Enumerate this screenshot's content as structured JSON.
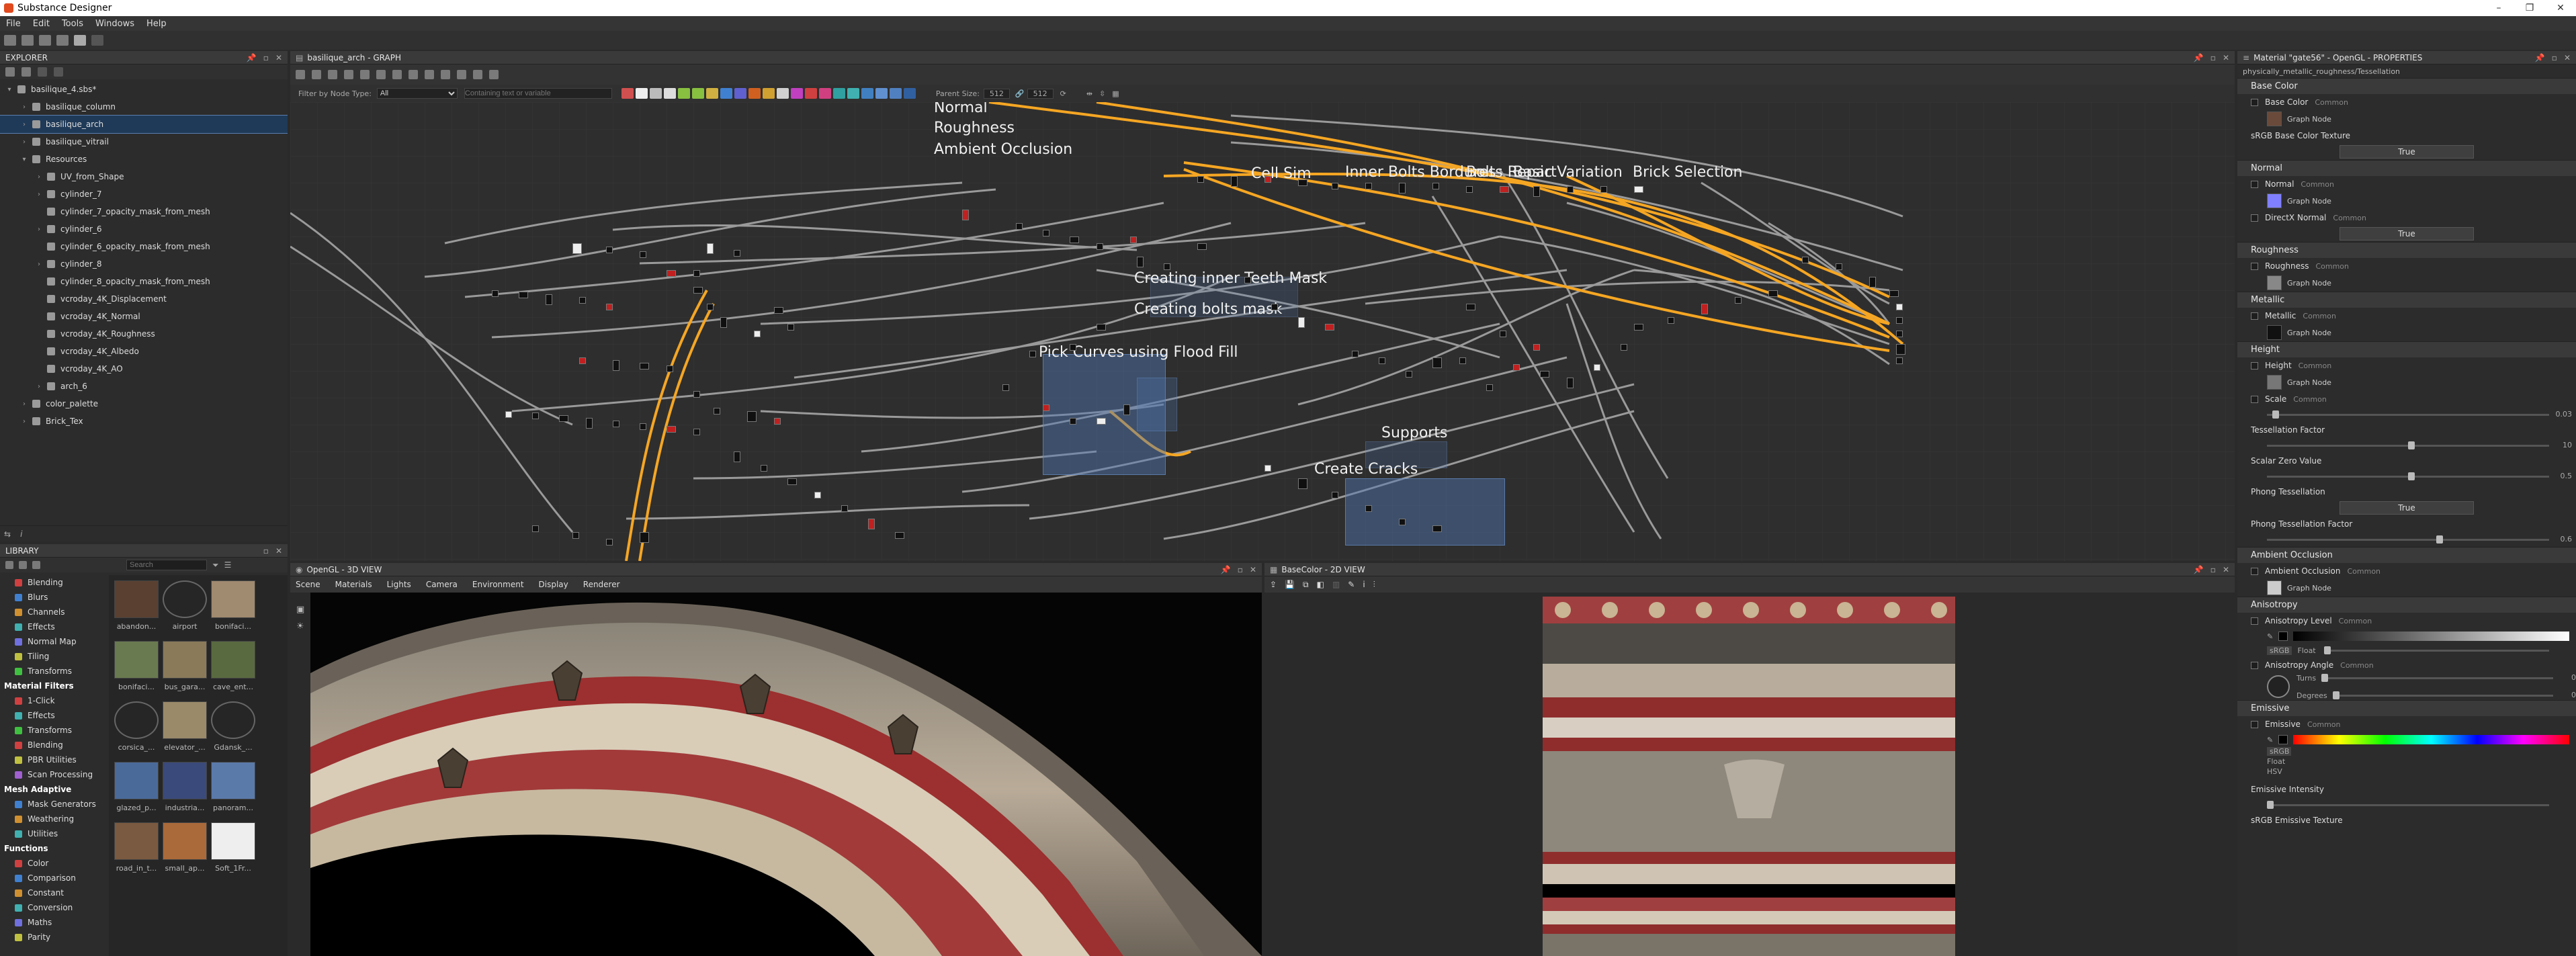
{
  "app": {
    "title": "Substance Designer"
  },
  "menu": [
    "File",
    "Edit",
    "Tools",
    "Windows",
    "Help"
  ],
  "explorer": {
    "title": "EXPLORER",
    "items": [
      {
        "label": "basilique_4.sbs*",
        "level": 0,
        "tw": "▾"
      },
      {
        "label": "basilique_column",
        "level": 1,
        "tw": "›"
      },
      {
        "label": "basilique_arch",
        "level": 1,
        "tw": "›",
        "selected": true
      },
      {
        "label": "basilique_vitrail",
        "level": 1,
        "tw": "›"
      },
      {
        "label": "Resources",
        "level": 1,
        "tw": "▾"
      },
      {
        "label": "UV_from_Shape",
        "level": 2,
        "tw": "›"
      },
      {
        "label": "cylinder_7",
        "level": 2,
        "tw": "›"
      },
      {
        "label": "cylinder_7_opacity_mask_from_mesh",
        "level": 2,
        "tw": ""
      },
      {
        "label": "cylinder_6",
        "level": 2,
        "tw": "›"
      },
      {
        "label": "cylinder_6_opacity_mask_from_mesh",
        "level": 2,
        "tw": ""
      },
      {
        "label": "cylinder_8",
        "level": 2,
        "tw": "›"
      },
      {
        "label": "cylinder_8_opacity_mask_from_mesh",
        "level": 2,
        "tw": ""
      },
      {
        "label": "vcroday_4K_Displacement",
        "level": 2,
        "tw": ""
      },
      {
        "label": "vcroday_4K_Normal",
        "level": 2,
        "tw": ""
      },
      {
        "label": "vcroday_4K_Roughness",
        "level": 2,
        "tw": ""
      },
      {
        "label": "vcroday_4K_Albedo",
        "level": 2,
        "tw": ""
      },
      {
        "label": "vcroday_4K_AO",
        "level": 2,
        "tw": ""
      },
      {
        "label": "arch_6",
        "level": 2,
        "tw": "›"
      },
      {
        "label": "color_palette",
        "level": 1,
        "tw": "›"
      },
      {
        "label": "Brick_Tex",
        "level": 1,
        "tw": "›"
      }
    ]
  },
  "library": {
    "title": "LIBRARY",
    "search_placeholder": "Search",
    "groups": [
      {
        "label": "Blending",
        "color": "#d04040"
      },
      {
        "label": "Blurs",
        "color": "#4080d0"
      },
      {
        "label": "Channels",
        "color": "#d09030"
      },
      {
        "label": "Effects",
        "color": "#40b0b0"
      },
      {
        "label": "Normal Map",
        "color": "#7070e0"
      },
      {
        "label": "Tiling",
        "color": "#c0c040"
      },
      {
        "label": "Transforms",
        "color": "#40c040"
      }
    ],
    "section2": "Material Filters",
    "group2": [
      {
        "label": "1-Click",
        "color": "#d04040"
      },
      {
        "label": "Effects",
        "color": "#40b0b0"
      },
      {
        "label": "Transforms",
        "color": "#40c040"
      },
      {
        "label": "Blending",
        "color": "#d04040"
      },
      {
        "label": "PBR Utilities",
        "color": "#c0c040"
      },
      {
        "label": "Scan Processing",
        "color": "#a060d0"
      }
    ],
    "section3": "Mesh Adaptive",
    "group3": [
      {
        "label": "Mask Generators",
        "color": "#4080d0"
      },
      {
        "label": "Weathering",
        "color": "#d09030"
      },
      {
        "label": "Utilities",
        "color": "#40b0b0"
      }
    ],
    "section4": "Functions",
    "group4": [
      {
        "label": "Color",
        "color": "#d04040"
      },
      {
        "label": "Comparison",
        "color": "#4080d0"
      },
      {
        "label": "Constant",
        "color": "#d09030"
      },
      {
        "label": "Conversion",
        "color": "#40b0b0"
      },
      {
        "label": "Maths",
        "color": "#7070e0"
      },
      {
        "label": "Parity",
        "color": "#c0c040"
      }
    ],
    "thumbs": [
      "abandon...",
      "airport",
      "bonifaci...",
      "bonifaci...",
      "bus_gara...",
      "cave_ent...",
      "corsica_...",
      "elevator_...",
      "Gdansk_...",
      "glazed_p...",
      "industria...",
      "panoram...",
      "road_in_t...",
      "small_ap...",
      "Soft_1Fr..."
    ]
  },
  "graph": {
    "title": "basilique_arch - GRAPH",
    "filter_label": "Filter by Node Type:",
    "filter_value": "All",
    "search_placeholder": "Containing text or variable",
    "parent_size_label": "Parent Size:",
    "parent_size_1": "512",
    "parent_size_2": "512",
    "labels": [
      "Normal",
      "Roughness",
      "Ambient Occlusion",
      "Cell Sim",
      "Inner Bolts Bordures",
      "Bolts Repart",
      "Basic Variation",
      "Brick Selection",
      "Creating inner Teeth Mask",
      "Creating bolts mask",
      "Pick Curves using Flood Fill",
      "Supports",
      "Create Cracks"
    ]
  },
  "view3d": {
    "title": "OpenGL - 3D VIEW",
    "menu": [
      "Scene",
      "Materials",
      "Lights",
      "Camera",
      "Environment",
      "Display",
      "Renderer"
    ]
  },
  "view2d": {
    "title": "BaseColor - 2D VIEW"
  },
  "properties": {
    "title": "Material \"gate56\" - OpenGL - PROPERTIES",
    "subtitle": "physically_metallic_roughness/Tessellation",
    "common": "Common",
    "graph_node": "Graph Node",
    "true_label": "True",
    "base_color_sec": "Base Color",
    "base_color": "Base Color",
    "srgb_base": "sRGB Base Color Texture",
    "normal_sec": "Normal",
    "normal": "Normal",
    "directx_normal": "DirectX Normal",
    "roughness_sec": "Roughness",
    "roughness": "Roughness",
    "metallic_sec": "Metallic",
    "metallic": "Metallic",
    "height_sec": "Height",
    "height": "Height",
    "scale": "Scale",
    "scale_value": "0.03",
    "tess_factor": "Tessellation Factor",
    "tess_factor_value": "10",
    "scalar_zero": "Scalar Zero Value",
    "scalar_zero_value": "0.5",
    "phong_tess": "Phong Tessellation",
    "phong_tess_factor": "Phong Tessellation Factor",
    "phong_value": "0.6",
    "ao_sec": "Ambient Occlusion",
    "ao": "Ambient Occlusion",
    "aniso_sec": "Anisotropy",
    "aniso_level": "Anisotropy Level",
    "srgb": "sRGB",
    "float": "Float",
    "aniso_angle": "Anisotropy Angle",
    "turns": "Turns",
    "degrees": "Degrees",
    "zero": "0",
    "emissive_sec": "Emissive",
    "emissive": "Emissive",
    "hsv": "HSV",
    "emissive_intensity": "Emissive Intensity",
    "srgb_emissive": "sRGB Emissive Texture"
  }
}
